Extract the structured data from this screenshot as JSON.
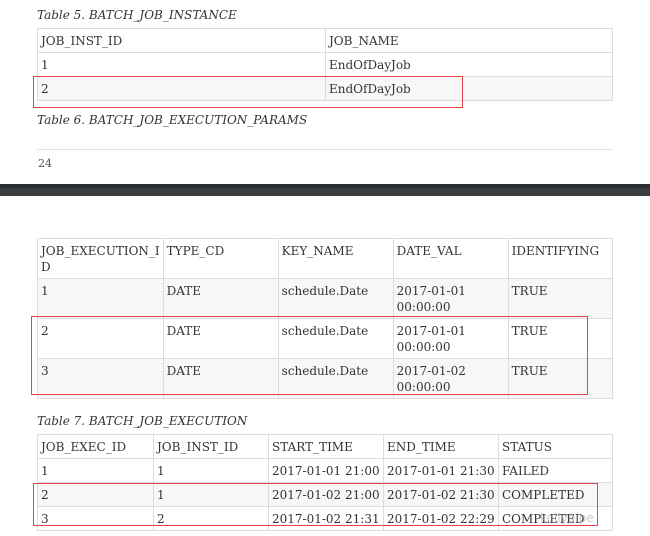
{
  "table5": {
    "caption": "Table 5. BATCH_JOB_INSTANCE",
    "headers": [
      "JOB_INST_ID",
      "JOB_NAME"
    ],
    "rows": [
      [
        "1",
        "EndOfDayJob"
      ],
      [
        "2",
        "EndOfDayJob"
      ]
    ]
  },
  "table6": {
    "caption": "Table 6. BATCH_JOB_EXECUTION_PARAMS",
    "headers": [
      "JOB_EXECUTION_I\nD",
      "TYPE_CD",
      "KEY_NAME",
      "DATE_VAL",
      "IDENTIFYING"
    ],
    "rows": [
      [
        "1",
        "DATE",
        "schedule.Date",
        "2017-01-01\n00:00:00",
        "TRUE"
      ],
      [
        "2",
        "DATE",
        "schedule.Date",
        "2017-01-01\n00:00:00",
        "TRUE"
      ],
      [
        "3",
        "DATE",
        "schedule.Date",
        "2017-01-02\n00:00:00",
        "TRUE"
      ]
    ]
  },
  "page_number": "24",
  "table7": {
    "caption": "Table 7. BATCH_JOB_EXECUTION",
    "headers": [
      "JOB_EXEC_ID",
      "JOB_INST_ID",
      "START_TIME",
      "END_TIME",
      "STATUS"
    ],
    "rows": [
      [
        "1",
        "1",
        "2017-01-01 21:00",
        "2017-01-01 21:30",
        "FAILED"
      ],
      [
        "2",
        "1",
        "2017-01-02 21:00",
        "2017-01-02 21:30",
        "COMPLETED"
      ],
      [
        "3",
        "2",
        "2017-01-02 21:31",
        "2017-01-02 22:29",
        "COMPLETED"
      ]
    ]
  },
  "watermark": "kellypipe",
  "colors": {
    "highlight": "#e0474c",
    "border": "#dcdcdc",
    "row_shade": "#f7f7f7",
    "page_break": "#3b3f42"
  }
}
